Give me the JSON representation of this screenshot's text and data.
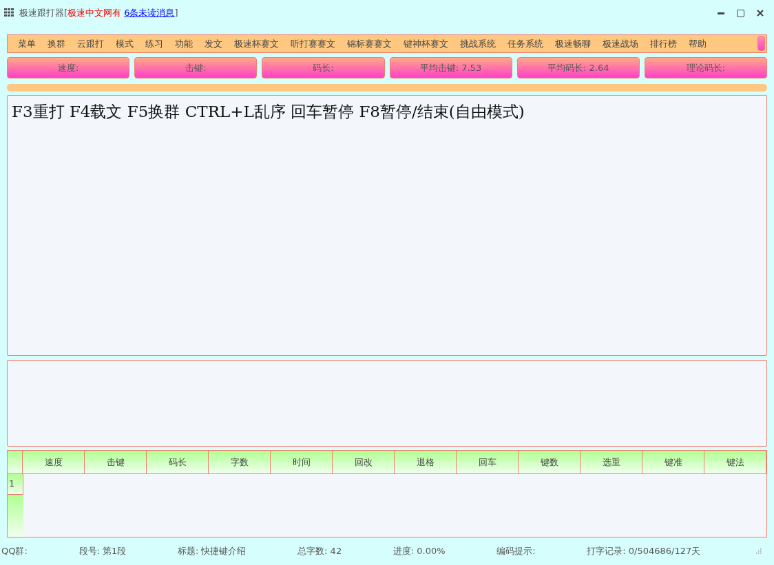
{
  "window": {
    "title": "极速跟打器[",
    "notice": "极速中文网有",
    "link": "6条未读消息",
    "close_bracket": "]"
  },
  "menu": [
    "菜单",
    "换群",
    "云跟打",
    "模式",
    "练习",
    "功能",
    "发文",
    "极速杯赛文",
    "听打赛赛文",
    "锦标赛赛文",
    "键神杯赛文",
    "挑战系统",
    "任务系统",
    "极速畅聊",
    "极速战场",
    "排行榜",
    "帮助"
  ],
  "stats": [
    "速度:",
    "击键:",
    "码长:",
    "平均击键: 7.53",
    "平均码长: 2.64",
    "理论码长:"
  ],
  "text": "F3重打 F4载文 F5换群 CTRL+L乱序 回车暂停 F8暂停/结束(自由模式)",
  "table": {
    "columns": [
      "速度",
      "击键",
      "码长",
      "字数",
      "时间",
      "回改",
      "退格",
      "回车",
      "键数",
      "选重",
      "键准",
      "键法"
    ],
    "rows": [
      "1"
    ]
  },
  "status_bar": [
    "QQ群:",
    "段号: 第1段",
    "标题: 快捷键介绍",
    "总字数: 42",
    "进度: 0.00%",
    "编码提示:",
    "打字记录: 0/504686/127天"
  ]
}
